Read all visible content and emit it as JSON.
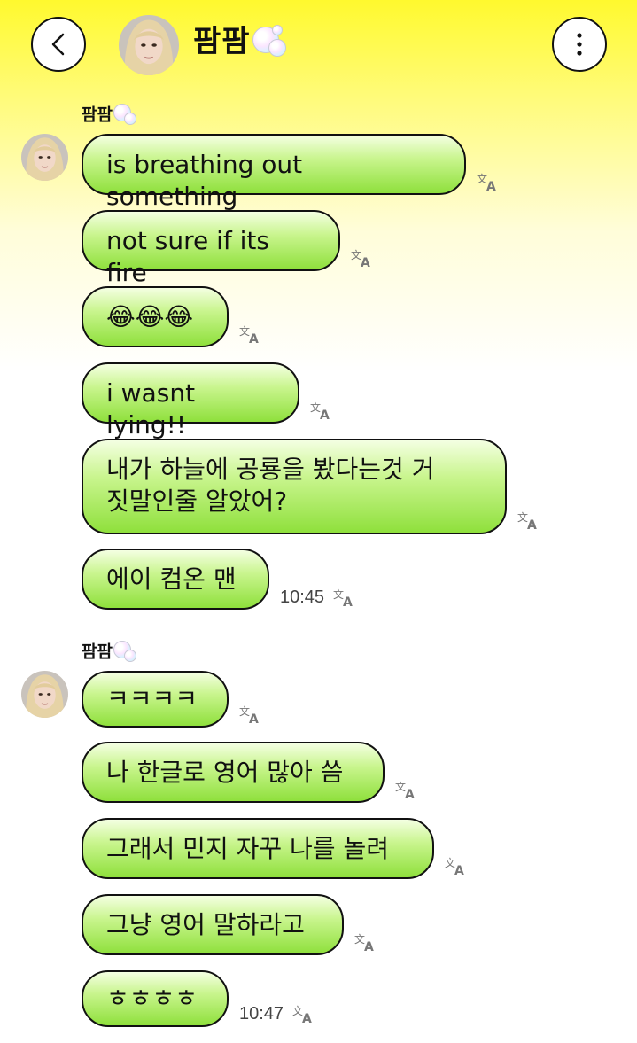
{
  "header": {
    "title": "팜팜"
  },
  "groups": [
    {
      "sender": "팜팜",
      "messages": [
        {
          "text": "is breathing out something"
        },
        {
          "text": "not sure if its fire"
        },
        {
          "text": "😂😂😂"
        },
        {
          "text": "i wasnt lying!!"
        },
        {
          "text": "내가 하늘에 공룡을 봤다는것 거\n짓말인줄 알았어?"
        },
        {
          "text": "에이 컴온 맨",
          "time": "10:45"
        }
      ]
    },
    {
      "sender": "팜팜",
      "messages": [
        {
          "text": "ㅋㅋㅋㅋ"
        },
        {
          "text": "나 한글로 영어 많아 씀"
        },
        {
          "text": "그래서 민지 자꾸 나를 놀려"
        },
        {
          "text": "그냥 영어 말하라고"
        },
        {
          "text": "ㅎㅎㅎㅎ",
          "time": "10:47"
        }
      ]
    }
  ],
  "icons": {
    "back": "chevron-left-icon",
    "more": "more-vertical-icon",
    "translate": "translate-icon"
  },
  "colors": {
    "bubble_top": "#f4ffe2",
    "bubble_bottom": "#8fe03c",
    "header_bg": "#fff92e"
  }
}
